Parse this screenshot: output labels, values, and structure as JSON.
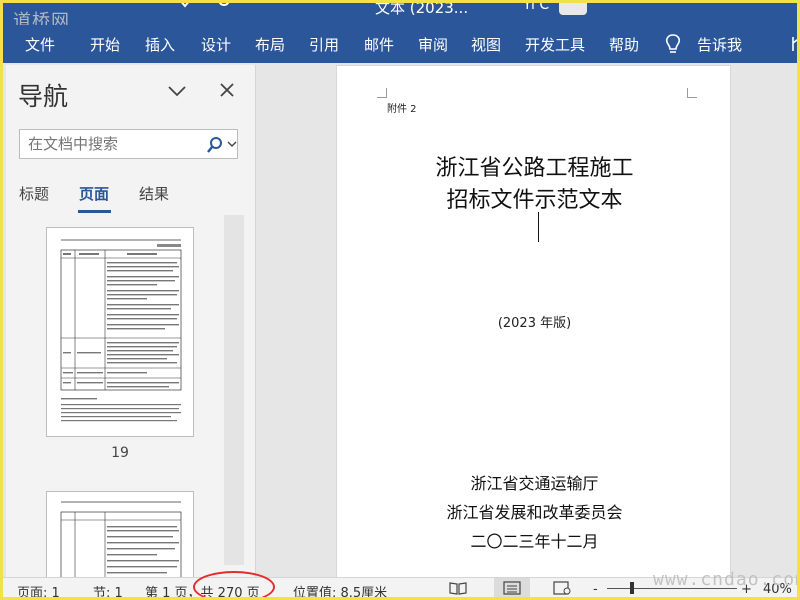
{
  "window": {
    "watermark": "道桥网",
    "title_fragment": "文本 (2023...",
    "user": "Yi C"
  },
  "ribbon": {
    "tabs": [
      "文件",
      "开始",
      "插入",
      "设计",
      "布局",
      "引用",
      "邮件",
      "审阅",
      "视图",
      "开发工具",
      "帮助"
    ],
    "tell_me": "告诉我"
  },
  "nav_pane": {
    "title": "导航",
    "search_placeholder": "在文档中搜索",
    "tabs": [
      "标题",
      "页面",
      "结果"
    ],
    "active_tab": "页面",
    "thumbnails": [
      {
        "page_number": "19"
      }
    ]
  },
  "document": {
    "attachment_label": "附件 2",
    "title_line1": "浙江省公路工程施工",
    "title_line2": "招标文件示范文本",
    "edition": "(2023 年版)",
    "issuer1": "浙江省交通运输厅",
    "issuer2": "浙江省发展和改革委员会",
    "date": "二〇二三年十二月"
  },
  "status_bar": {
    "page": "页面: 1",
    "section": "节: 1",
    "page_of": "第 1 页，共 270 页",
    "position": "位置值: 8.5厘米",
    "zoom_minus": "-",
    "zoom_plus": "+",
    "zoom": "40%"
  },
  "overlay": {
    "watermark_url": "www.cndao.com"
  },
  "colors": {
    "ribbon": "#2b579a",
    "highlight_ring": "#e52b2b",
    "frame_border": "#f2e24a"
  }
}
